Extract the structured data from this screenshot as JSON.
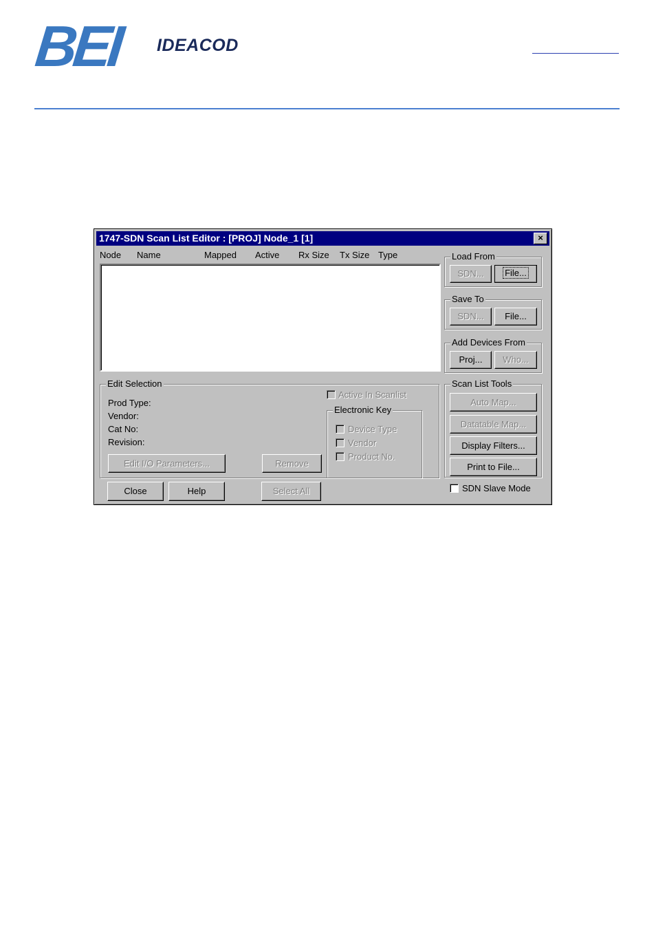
{
  "header": {
    "brand_big": "BEI",
    "brand_small": "IDEACOD"
  },
  "dialog": {
    "title": "1747-SDN Scan List Editor : [PROJ] Node_1 [1]",
    "close_glyph": "×",
    "columns": [
      "Node",
      "Name",
      "Mapped",
      "Active",
      "Rx Size",
      "Tx Size",
      "Type"
    ],
    "load_from": {
      "label": "Load From",
      "sdn": "SDN...",
      "file": "File..."
    },
    "save_to": {
      "label": "Save To",
      "sdn": "SDN...",
      "file": "File..."
    },
    "add_devices": {
      "label": "Add Devices From",
      "proj": "Proj...",
      "who": "Who..."
    },
    "scan_tools": {
      "label": "Scan List Tools",
      "auto_map": "Auto Map...",
      "datatable_map": "Datatable Map...",
      "display_filters": "Display Filters...",
      "print_to_file": "Print to File..."
    },
    "edit_selection": {
      "label": "Edit Selection",
      "prod_type": "Prod Type:",
      "vendor": "Vendor:",
      "cat_no": "Cat No:",
      "revision": "Revision:",
      "edit_io": "Edit I/O Parameters...",
      "remove": "Remove",
      "active_in_scanlist": "Active In Scanlist",
      "electronic_key": "Electronic Key",
      "device_type": "Device Type",
      "vendor_key": "Vendor",
      "product_no": "Product No."
    },
    "footer": {
      "close": "Close",
      "help": "Help",
      "select_all": "Select All",
      "sdn_slave_mode": "SDN Slave Mode"
    }
  }
}
